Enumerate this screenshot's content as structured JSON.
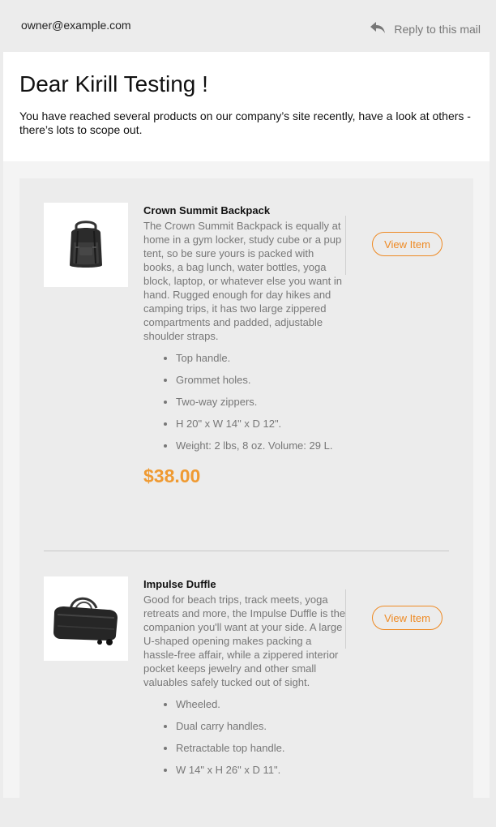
{
  "header": {
    "sender": "owner@example.com",
    "reply_label": "Reply to this mail",
    "reply_icon": "reply-arrow-icon"
  },
  "intro": {
    "greeting": "Dear Kirill Testing !",
    "message": "You have reached several products on our company’s site recently, have a look at others - there’s lots to scope out."
  },
  "colors": {
    "accent": "#ee8a24",
    "price": "#ef9a32",
    "muted_text": "#777777"
  },
  "products": [
    {
      "name": "Crown Summit Backpack",
      "description": "The Crown Summit Backpack is equally at home in a gym locker, study cube or a pup tent, so be sure yours is packed with books, a bag lunch, water bottles, yoga block, laptop, or whatever else you want in hand. Rugged enough for day hikes and camping trips, it has two large zippered compartments and padded, adjustable shoulder straps.",
      "features": [
        "Top handle.",
        "Grommet holes.",
        "Two-way zippers.",
        "H 20\" x W 14\" x D 12\".",
        "Weight: 2 lbs, 8 oz. Volume: 29 L."
      ],
      "price": "$38.00",
      "button_label": "View Item",
      "image_icon": "backpack-image"
    },
    {
      "name": "Impulse Duffle",
      "description": "Good for beach trips, track meets, yoga retreats and more, the Impulse Duffle is the companion you'll want at your side. A large U-shaped opening makes packing a hassle-free affair, while a zippered interior pocket keeps jewelry and other small valuables safely tucked out of sight.",
      "features": [
        "Wheeled.",
        "Dual carry handles.",
        "Retractable top handle.",
        "W 14\" x H 26\" x D 11\"."
      ],
      "button_label": "View Item",
      "image_icon": "duffle-image"
    }
  ]
}
